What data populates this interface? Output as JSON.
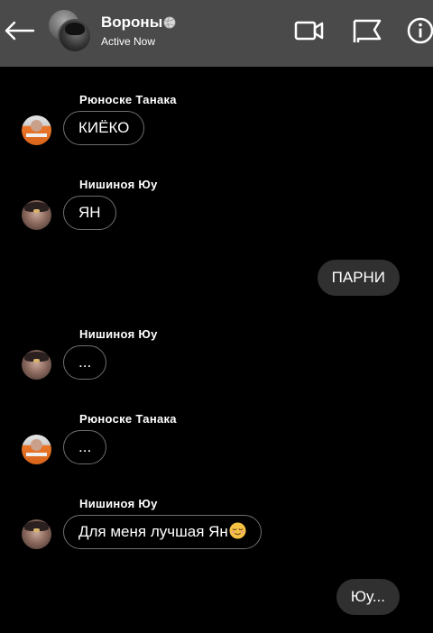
{
  "header": {
    "title": "Вороны",
    "title_icon": "volleyball-icon",
    "status": "Active Now",
    "icons": [
      "back-arrow-icon",
      "video-call-icon",
      "flag-icon",
      "info-icon"
    ]
  },
  "messages": [
    {
      "direction": "in",
      "sender": "Рюноске Танака",
      "avatar": "tanaka",
      "text": "КИЁКО"
    },
    {
      "direction": "in",
      "sender": "Нишиноя Юу",
      "avatar": "nishinoya",
      "text": "ЯН"
    },
    {
      "direction": "out",
      "text": "ПАРНИ"
    },
    {
      "direction": "in",
      "sender": "Нишиноя Юу",
      "avatar": "nishinoya",
      "text": "..."
    },
    {
      "direction": "in",
      "sender": "Рюноске Танака",
      "avatar": "tanaka",
      "text": "..."
    },
    {
      "direction": "in",
      "sender": "Нишиноя Юу",
      "avatar": "nishinoya",
      "text": "Для меня лучшая Ян",
      "emoji": "relieved-face-emoji"
    },
    {
      "direction": "out",
      "text": "Юу..."
    }
  ],
  "colors": {
    "background": "#000000",
    "header": "#4a4a4a",
    "outgoing_bubble": "#303030",
    "incoming_border": "#6e6e6e",
    "text": "#ffffff"
  }
}
